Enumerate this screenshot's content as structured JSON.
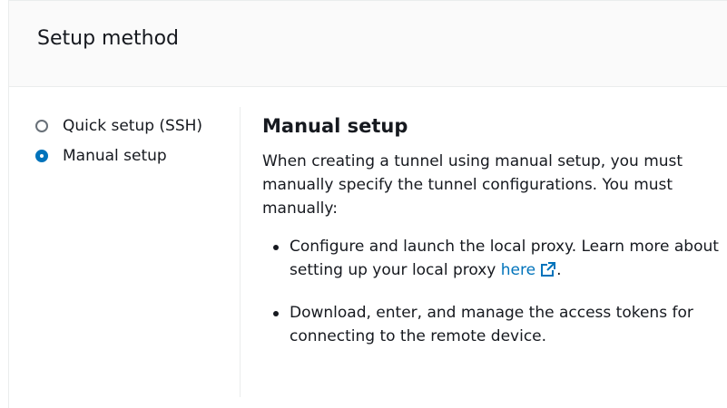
{
  "panel": {
    "title": "Setup method"
  },
  "setup_options": [
    {
      "label": "Quick setup (SSH)",
      "selected": false
    },
    {
      "label": "Manual setup",
      "selected": true
    }
  ],
  "content": {
    "heading": "Manual setup",
    "intro": "When creating a tunnel using manual setup, you must manually specify the tunnel configurations. You must manually:",
    "bullet1_text": "Configure and launch the local proxy. Learn more about setting up your local proxy ",
    "bullet1_link": "here",
    "bullet1_suffix": ".",
    "bullet2_text": "Download, enter, and manage the access tokens for connecting to the remote device."
  },
  "colors": {
    "accent": "#0073bb",
    "text": "#16191f",
    "header_bg": "#fafafa",
    "border": "#eaeded"
  },
  "icons": {
    "external_link": "external-link-icon"
  }
}
